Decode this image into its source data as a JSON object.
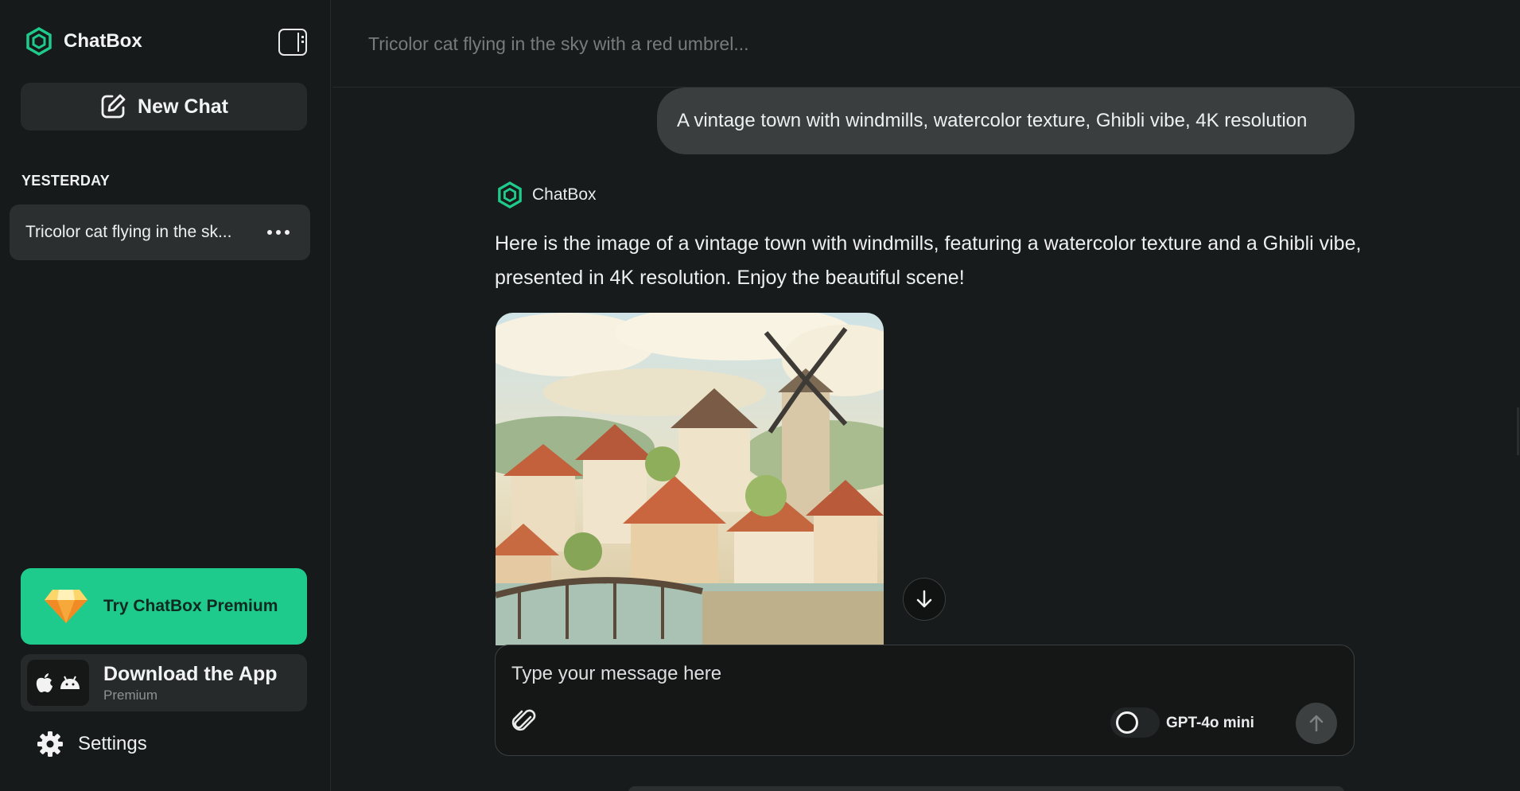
{
  "app": {
    "name": "ChatBox"
  },
  "sidebar": {
    "new_chat_label": "New Chat",
    "section_label": "YESTERDAY",
    "history": [
      {
        "label": "Tricolor cat flying in the sk..."
      }
    ],
    "premium_label": "Try ChatBox Premium",
    "download_title": "Download the App",
    "download_sub": "Premium",
    "settings_label": "Settings"
  },
  "header": {
    "chat_title": "Tricolor cat flying in the sky with a red umbrel..."
  },
  "conversation": {
    "user_message": "A vintage town with windmills, watercolor texture, Ghibli vibe, 4K resolution",
    "bot_name": "ChatBox",
    "bot_message": "Here is the image of a vintage town with windmills, featuring a watercolor texture and a Ghibli vibe, presented in 4K resolution. Enjoy the beautiful scene!",
    "image_icon": "watercolor-town-image"
  },
  "composer": {
    "placeholder": "Type your message here",
    "model": "GPT-4o mini"
  },
  "colors": {
    "accent": "#1fcb8c",
    "background": "#181b1b",
    "panel": "#262a2a",
    "bubble": "#3a3e3e"
  },
  "icons": [
    "logo-icon",
    "sidebar-toggle-icon",
    "edit-icon",
    "more-icon",
    "diamond-icon",
    "apple-icon",
    "android-icon",
    "gear-icon",
    "arrow-down-icon",
    "paperclip-icon",
    "arrow-up-icon"
  ]
}
